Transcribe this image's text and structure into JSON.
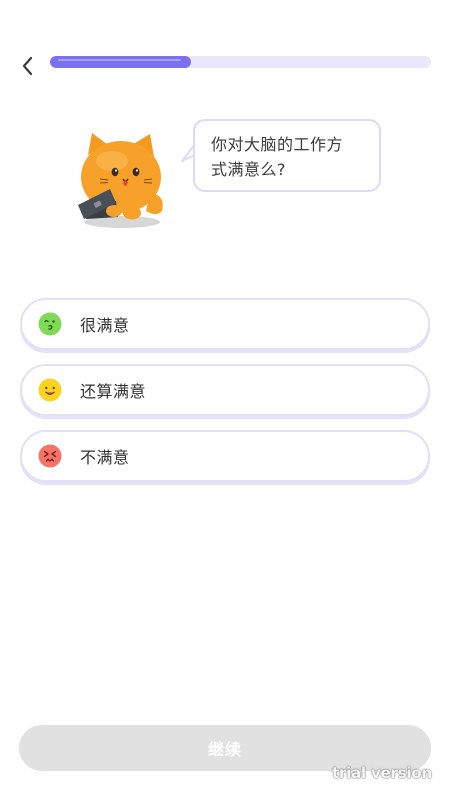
{
  "header": {
    "back_icon": "chevron-left-icon",
    "progress": 0.37,
    "progress_color": "#7b6ff2",
    "progress_track_color": "#e9e8fb"
  },
  "question": {
    "line1": "你对大脑的工作方",
    "line2": "式满意么?"
  },
  "options": [
    {
      "label": "很满意",
      "icon": "happy-green-face-icon",
      "color": "#7ed957"
    },
    {
      "label": "还算满意",
      "icon": "smile-yellow-face-icon",
      "color": "#ffd21f"
    },
    {
      "label": "不满意",
      "icon": "upset-red-face-icon",
      "color": "#f47467"
    }
  ],
  "continue_label": "继续",
  "watermark": "trial version"
}
